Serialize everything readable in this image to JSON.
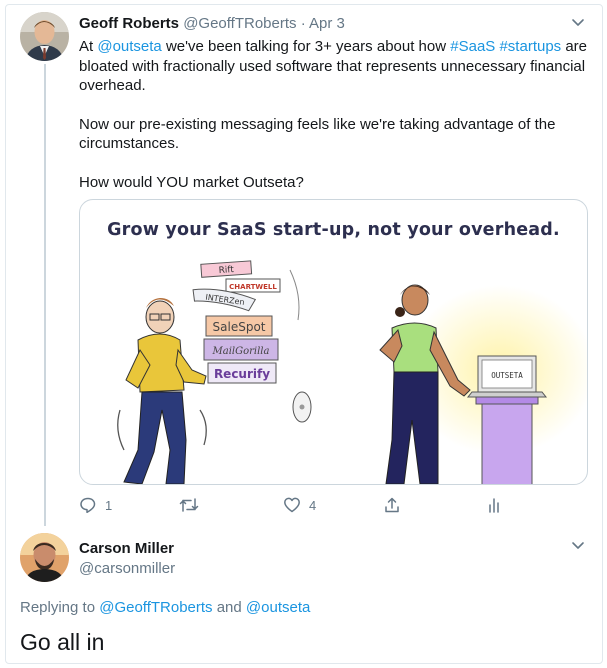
{
  "tweet": {
    "author_name": "Geoff Roberts",
    "author_handle": "@GeoffTRoberts",
    "separator": "·",
    "date": "Apr 3",
    "text": {
      "p1_pre": "At ",
      "p1_mention": "@outseta",
      "p1_mid": " we've been talking for 3+ years about how ",
      "p1_tag1": "#SaaS",
      "p1_space": " ",
      "p1_tag2": "#startups",
      "p1_post": " are bloated with fractionally used software that represents unnecessary financial overhead.",
      "p2": "Now our pre-existing messaging feels like we're taking advantage of the circumstances.",
      "p3": "How would YOU market Outseta?"
    },
    "card": {
      "headline": "Grow your SaaS start-up, not your overhead.",
      "box_labels": [
        "Rift",
        "CHARTWELL",
        "INTERZen",
        "SaleSpot",
        "MailGorilla",
        "Recurify"
      ],
      "laptop_label": "OUTSETA"
    },
    "actions": {
      "reply_count": "1",
      "retweet_count": "",
      "like_count": "4"
    }
  },
  "reply": {
    "author_name": "Carson Miller",
    "author_handle": "@carsonmiller",
    "replying_prefix": "Replying to ",
    "replying_user1": "@GeoffTRoberts",
    "replying_and": " and ",
    "replying_user2": "@outseta",
    "text": "Go all in"
  },
  "colors": {
    "link": "#1b95e0",
    "muted": "#657786",
    "text": "#14171a",
    "border": "#e1e8ed"
  }
}
